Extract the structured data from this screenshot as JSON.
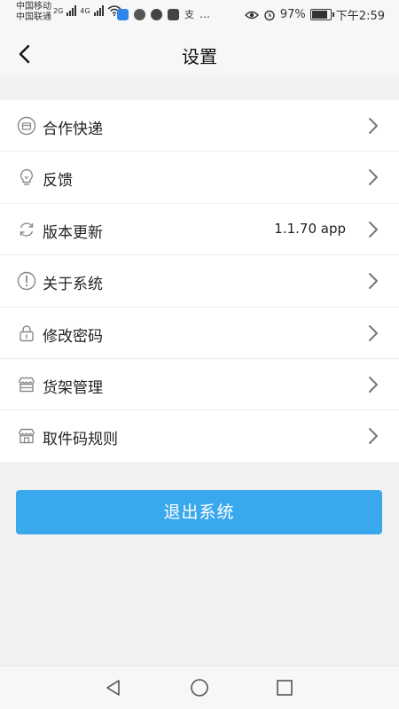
{
  "status_bar": {
    "carrier1": "中国移动",
    "carrier2": "中国联通",
    "net1": "2G",
    "net2": "4G",
    "battery": "97%",
    "time": "下午2:59",
    "more": "…",
    "alipay": "支"
  },
  "header": {
    "title": "设置",
    "back_icon": "chevron-left-icon"
  },
  "settings": {
    "items": [
      {
        "label": "合作快递",
        "icon": "courier-icon",
        "value": ""
      },
      {
        "label": "反馈",
        "icon": "lightbulb-icon",
        "value": ""
      },
      {
        "label": "版本更新",
        "icon": "refresh-icon",
        "value": "1.1.70 app"
      },
      {
        "label": "关于系统",
        "icon": "info-icon",
        "value": ""
      },
      {
        "label": "修改密码",
        "icon": "lock-icon",
        "value": ""
      },
      {
        "label": "货架管理",
        "icon": "shelf-icon",
        "value": ""
      },
      {
        "label": "取件码规则",
        "icon": "store-icon",
        "value": ""
      }
    ]
  },
  "logout": {
    "label": "退出系统"
  },
  "colors": {
    "accent": "#3aa8ec",
    "background": "#f2f2f4"
  }
}
